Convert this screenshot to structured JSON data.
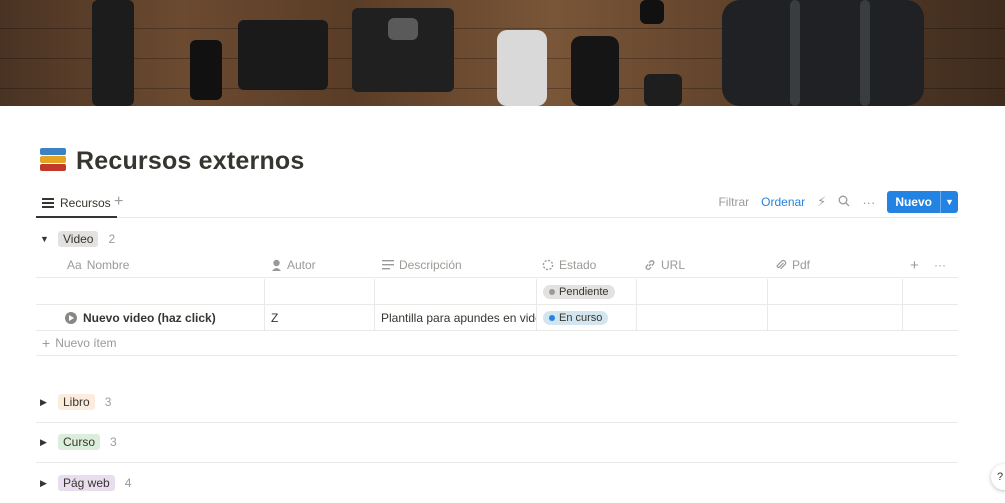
{
  "page": {
    "title": "Recursos externos",
    "icon": "books-icon"
  },
  "cover": {
    "description_icon": "camera-gear-cover-image"
  },
  "view": {
    "tab_label": "Recursos",
    "tab_icon": "list-icon",
    "add_view_icon": "plus-icon"
  },
  "toolbar": {
    "filter_label": "Filtrar",
    "sort_label": "Ordenar",
    "automation_icon": "lightning-icon",
    "search_icon": "search-icon",
    "more_icon": "more-icon",
    "new_label": "Nuevo",
    "new_chevron": "chevron-down-icon"
  },
  "table": {
    "columns": [
      {
        "label": "Nombre",
        "prefix": "Aa",
        "icon": "text-icon"
      },
      {
        "label": "Autor",
        "icon": "person-icon"
      },
      {
        "label": "Descripción",
        "icon": "lines-icon"
      },
      {
        "label": "Estado",
        "icon": "status-icon"
      },
      {
        "label": "URL",
        "icon": "link-icon"
      },
      {
        "label": "Pdf",
        "icon": "paperclip-icon"
      }
    ],
    "add_column_symbol": "+",
    "more_symbol": "···",
    "new_item_label": "Nuevo ítem"
  },
  "groups": [
    {
      "label": "Video",
      "count": "2",
      "expanded": true,
      "color": "#e3e2e0",
      "rows": [
        {
          "name": "",
          "author": "",
          "description": "",
          "status": "Pendiente",
          "status_bg": "#e3e2e0",
          "status_dot": "#9b9a97"
        },
        {
          "name": "Nuevo video (haz click)",
          "author": "Z",
          "description": "Plantilla para apundes en video",
          "status": "En curso",
          "status_bg": "#d3e5ef",
          "status_dot": "#2383e2"
        }
      ]
    },
    {
      "label": "Libro",
      "count": "3",
      "expanded": false,
      "color": "#fbecdd"
    },
    {
      "label": "Curso",
      "count": "3",
      "expanded": false,
      "color": "#dbeddb"
    },
    {
      "label": "Pág web",
      "count": "4",
      "expanded": false,
      "color": "#e8deee"
    }
  ],
  "help_button": {
    "label": "?"
  }
}
